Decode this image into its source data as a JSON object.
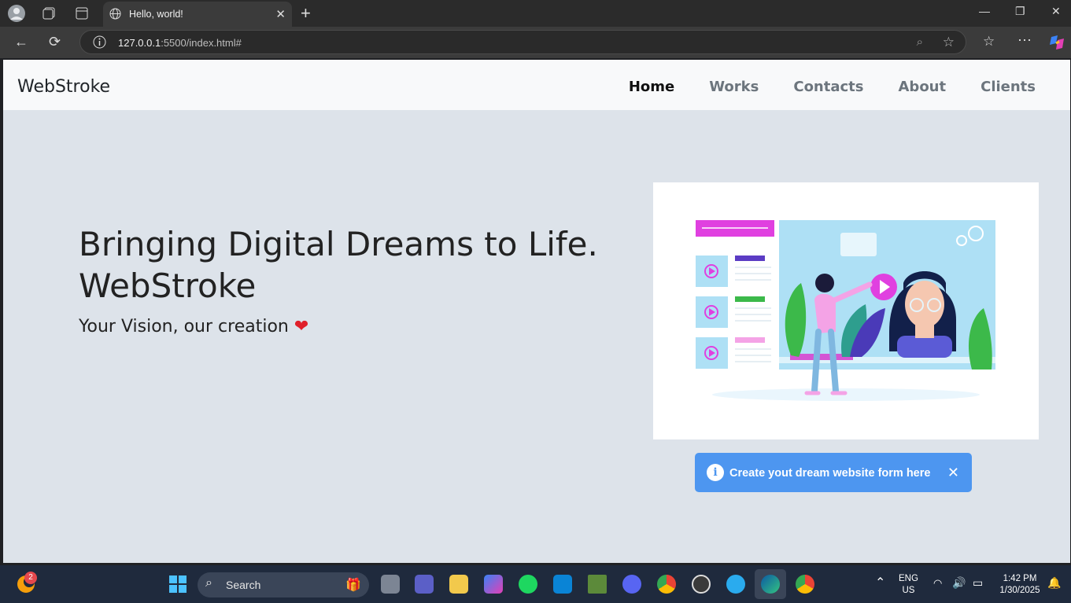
{
  "browser": {
    "tab_title": "Hello, world!",
    "url_host": "127.0.0.1",
    "url_path": ":5500/index.html#"
  },
  "site": {
    "brand": "WebStroke",
    "nav": [
      "Home",
      "Works",
      "Contacts",
      "About",
      "Clients"
    ],
    "active_nav": "Home",
    "hero_title_line1": "Bringing Digital Dreams to Life.",
    "hero_title_line2": "WebStroke",
    "hero_subtitle": "Your Vision, our creation",
    "toast_message": "Create yout dream website form here"
  },
  "taskbar": {
    "search_placeholder": "Search",
    "notification_badge": "2",
    "lang_line1": "ENG",
    "lang_line2": "US",
    "time": "1:42 PM",
    "date": "1/30/2025"
  },
  "colors": {
    "accent": "#4d96f0",
    "page_bg": "#dde3ea",
    "illustration_magenta": "#e040e0",
    "illustration_sky": "#aee0f5"
  }
}
